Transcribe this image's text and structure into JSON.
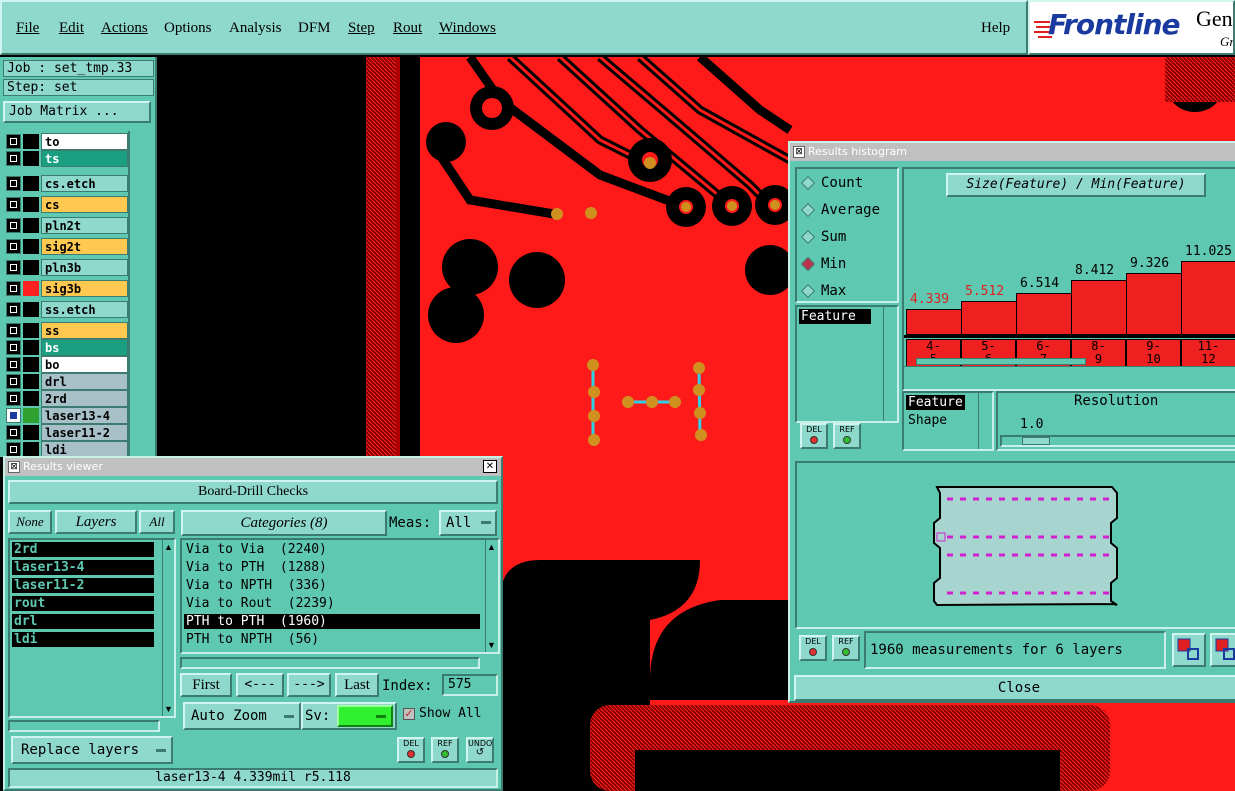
{
  "menubar": {
    "items": [
      "File",
      "Edit",
      "Actions",
      "Options",
      "Analysis",
      "DFM",
      "Step",
      "Rout",
      "Windows"
    ],
    "help": "Help"
  },
  "logo": {
    "brand": "Frontline",
    "partial": "Gen",
    "partial2": "Gr"
  },
  "left_panel": {
    "job": "Job : set_tmp.33",
    "step": "Step: set",
    "job_matrix": "Job Matrix ...",
    "layers": [
      {
        "name": "to",
        "bg": "#ffffff",
        "swatch": "#000000",
        "fg": "#000000"
      },
      {
        "name": "ts",
        "bg": "#1aa080",
        "swatch": "#000000",
        "fg": "#ffffff"
      },
      {
        "name": "cs.etch",
        "bg": "#8fd8cc",
        "swatch": "#000000",
        "fg": "#000000"
      },
      {
        "name": "cs",
        "bg": "#ffc850",
        "swatch": "#000000",
        "fg": "#000000"
      },
      {
        "name": "pln2t",
        "bg": "#8fd8cc",
        "swatch": "#000000",
        "fg": "#000000"
      },
      {
        "name": "sig2t",
        "bg": "#ffc850",
        "swatch": "#000000",
        "fg": "#000000"
      },
      {
        "name": "pln3b",
        "bg": "#8fd8cc",
        "swatch": "#000000",
        "fg": "#000000"
      },
      {
        "name": "sig3b",
        "bg": "#ffc850",
        "swatch": "#ff2020",
        "fg": "#000000"
      },
      {
        "name": "ss.etch",
        "bg": "#8fd8cc",
        "swatch": "#000000",
        "fg": "#000000"
      },
      {
        "name": "ss",
        "bg": "#ffc850",
        "swatch": "#000000",
        "fg": "#000000"
      },
      {
        "name": "bs",
        "bg": "#1aa080",
        "swatch": "#000000",
        "fg": "#ffffff"
      },
      {
        "name": "bo",
        "bg": "#ffffff",
        "swatch": "#000000",
        "fg": "#000000"
      },
      {
        "name": "drl",
        "bg": "#a8c0c8",
        "swatch": "#000000",
        "fg": "#000000"
      },
      {
        "name": "2rd",
        "bg": "#a8c0c8",
        "swatch": "#000000",
        "fg": "#000000"
      },
      {
        "name": "laser13-4",
        "bg": "#a8c0c8",
        "swatch": "#30a030",
        "fg": "#000000"
      },
      {
        "name": "laser11-2",
        "bg": "#a8c0c8",
        "swatch": "#000000",
        "fg": "#000000"
      },
      {
        "name": "ldi",
        "bg": "#a8c0c8",
        "swatch": "#000000",
        "fg": "#000000"
      }
    ]
  },
  "results_viewer": {
    "title": "Results viewer",
    "check_name": "Board-Drill Checks",
    "none_btn": "None",
    "layers_btn": "Layers",
    "all_btn": "All",
    "categories_btn": "Categories (8)",
    "meas_label": "Meas:",
    "meas_value": "All",
    "layer_list": [
      "2rd",
      "laser13-4",
      "laser11-2",
      "rout",
      "drl",
      "ldi"
    ],
    "categories": [
      "Via to Via  (2240)",
      "Via to PTH  (1288)",
      "Via to NPTH  (336)",
      "Via to Rout  (2239)",
      "PTH to PTH  (1960)",
      "PTH to NPTH  (56)"
    ],
    "selected_category": 4,
    "first": "First",
    "prev": "<---",
    "next": "--->",
    "last": "Last",
    "index_label": "Index:",
    "index_value": "575",
    "auto_zoom": "Auto Zoom",
    "sv_label": "Sv:",
    "show_all": "Show All",
    "replace_layers": "Replace layers",
    "del": "DEL",
    "ref": "REF",
    "undo": "UNDO",
    "status": "laser13-4 4.339mil  r5.118"
  },
  "histogram": {
    "title": "Results histogram",
    "modes": [
      "Count",
      "Average",
      "Sum",
      "Min",
      "Max"
    ],
    "selected_mode": "Min",
    "feature_label": "Feature",
    "formula": "Size(Feature) / Min(Feature)",
    "feature_opt": "Feature",
    "shape_opt": "Shape",
    "resolution_label": "Resolution",
    "resolution_value": "1.0",
    "measurements": "1960 measurements for 6 layers",
    "close": "Close",
    "del": "DEL",
    "ref": "REF"
  },
  "chart_data": {
    "type": "bar",
    "categories": [
      "4-\n5",
      "5-\n6",
      "6-\n7",
      "8-\n9",
      "9-\n10",
      "11-\n12"
    ],
    "values": [
      4.339,
      5.512,
      6.514,
      8.412,
      9.326,
      11.025
    ],
    "value_labels": [
      "4.339",
      "5.512",
      "6.514",
      "8.412",
      "9.326",
      "11.025"
    ],
    "title": "Size(Feature) / Min(Feature)",
    "ylim": [
      0,
      11.5
    ]
  }
}
